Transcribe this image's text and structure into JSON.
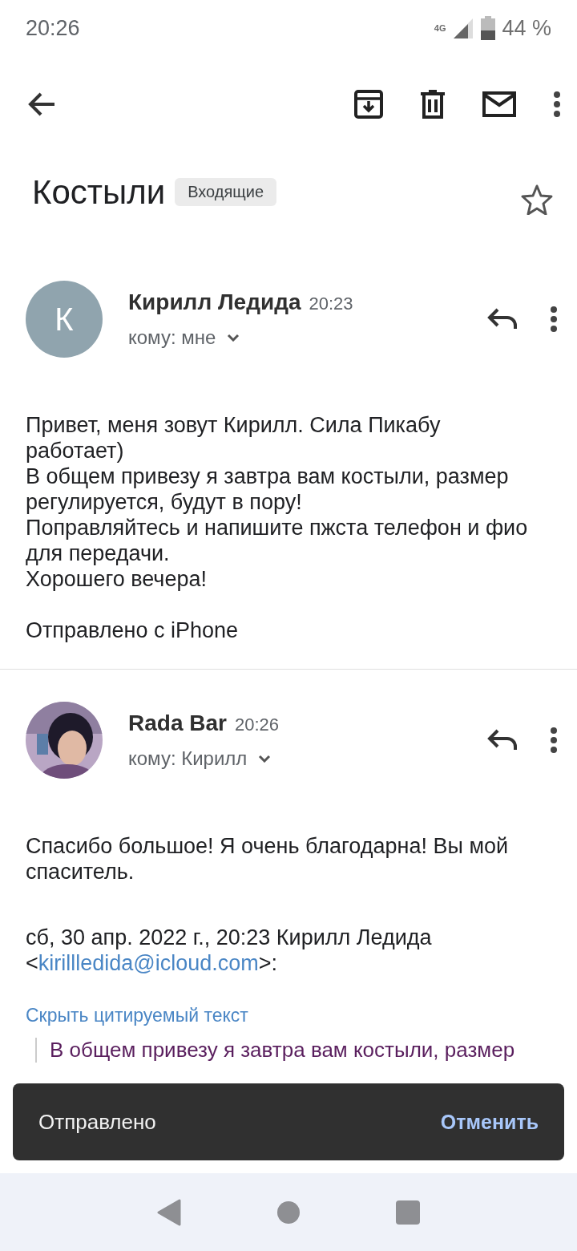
{
  "status_bar": {
    "time": "20:26",
    "network": "4G",
    "battery": "44 %"
  },
  "subject": {
    "title": "Костыли",
    "label": "Входящие",
    "starred": false
  },
  "messages": [
    {
      "avatar": {
        "kind": "letter",
        "letter": "К"
      },
      "sender": "Кирилл Ледида",
      "time": "20:23",
      "recipient": "кому: мне",
      "paragraphs": [
        "Привет, меня зовут Кирилл. Сила Пикабу работает)\nВ общем привезу я завтра вам костыли, размер регулируется, будут в пору!\nПоправляйтесь и напишите пжста телефон и фио для передачи.\nХорошего вечера!",
        "Отправлено с iPhone"
      ]
    },
    {
      "avatar": {
        "kind": "picture"
      },
      "sender": "Rada Bar",
      "time": "20:26",
      "recipient": "кому: Кирилл",
      "paragraphs": [
        "Спасибо большое! Я очень благодарна! Вы мой спаситель."
      ],
      "quote_header": {
        "prefix": "сб, 30 апр. 2022 г., 20:23 Кирилл Ледида <",
        "link": "kirillledida@icloud.com",
        "suffix": ">:"
      },
      "hide_quote": "Скрыть цитируемый текст",
      "quoted_line": "В общем привезу я завтра вам костыли, размер"
    }
  ],
  "snackbar": {
    "message": "Отправлено",
    "action": "Отменить"
  }
}
